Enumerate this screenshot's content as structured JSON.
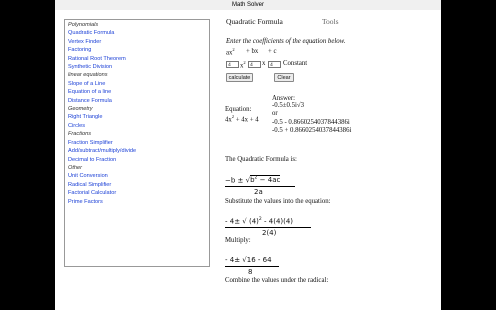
{
  "window": {
    "title": "Math Solver"
  },
  "sidebar": {
    "items": [
      {
        "type": "category",
        "label": "Polynomials"
      },
      {
        "type": "link",
        "label": "Quadratic Formula"
      },
      {
        "type": "link",
        "label": "Vertex Finder"
      },
      {
        "type": "link",
        "label": "Factoring"
      },
      {
        "type": "link",
        "label": "Rational Root Theorem"
      },
      {
        "type": "link",
        "label": "Synthetic Division"
      },
      {
        "type": "category",
        "label": "linear equations"
      },
      {
        "type": "link",
        "label": "Slope of a Line"
      },
      {
        "type": "link",
        "label": "Equation of a line"
      },
      {
        "type": "link",
        "label": "Distance Formula"
      },
      {
        "type": "category",
        "label": "Geometry"
      },
      {
        "type": "link",
        "label": "Right Triangle"
      },
      {
        "type": "link",
        "label": "Circles"
      },
      {
        "type": "category",
        "label": "Fractions"
      },
      {
        "type": "link",
        "label": "Fraction Simplifier"
      },
      {
        "type": "link",
        "label": "Add/subtract/multiply/divide"
      },
      {
        "type": "link",
        "label": "Decimal to Fraction"
      },
      {
        "type": "category",
        "label": "Other"
      },
      {
        "type": "link",
        "label": "Unit Conversion"
      },
      {
        "type": "link",
        "label": "Radical Simplifier"
      },
      {
        "type": "link",
        "label": "Factorial Calculator"
      },
      {
        "type": "link",
        "label": "Prime Factors"
      }
    ]
  },
  "tabs": {
    "active": "Quadratic Formula",
    "inactive": "Tools"
  },
  "form": {
    "instruction": "Enter the coefficients of the equation below.",
    "term_a": "ax",
    "term_a_exp": "2",
    "term_b": "+ bx",
    "term_c": "+ c",
    "input_a": "4",
    "input_b": "4",
    "input_c": "4",
    "sep_x2": "x",
    "sep_x2_exp": "2",
    "sep_x": "x",
    "constant_label": "Constant",
    "calculate_button": "calculate",
    "clear_button": "Clear"
  },
  "result": {
    "equation_label": "Equation:",
    "equation": "4x",
    "equation_exp": "2",
    "equation_rest": " + 4x + 4",
    "answer_label": "Answer:",
    "answer_line1": "-0.5±0.5i√3",
    "answer_or": "or",
    "answer_line2": "-0.5 - 0.8660254037844386i",
    "answer_line3": "-0.5 + 0.8660254037844386i"
  },
  "steps": {
    "formula_heading": "The Quadratic Formula is:",
    "formula_num_a": "−b ± √",
    "formula_num_b": "b",
    "formula_num_b_exp": "2",
    "formula_num_c": " − 4ac",
    "formula_den": "2a",
    "substitute_heading": "Substitute the values into the equation:",
    "sub_num": "- 4± √  (4)",
    "sub_num_exp": "2",
    "sub_num_rest": " - 4(4)(4)",
    "sub_den": "2(4)",
    "multiply_heading": "Multiply:",
    "mul_num": "- 4± √16 - 64",
    "mul_den": "8",
    "combine_heading": "Combine the values under the radical:"
  }
}
